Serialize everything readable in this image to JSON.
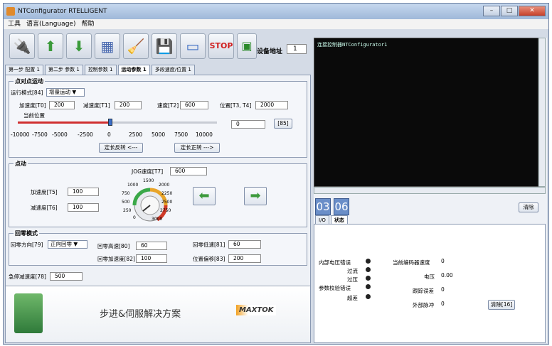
{
  "window": {
    "title": "NTConfigurator RTELLIGENT"
  },
  "menu": [
    "工具",
    "语言(Language)",
    "帮助"
  ],
  "toolbar": {
    "device_addr_label": "设备地址",
    "device_addr_value": "1"
  },
  "tabs": [
    "第一步 配置 1",
    "第二步 参数 1",
    "控制参数 1",
    "运动参数 1",
    "多段速度/位置 1"
  ],
  "p2p": {
    "title": "点对点运动",
    "mode_label": "运行模式[84]",
    "mode_value": "增量运动",
    "accel_label": "加速度[T0]",
    "accel_value": "200",
    "decel_label": "减速度[T1]",
    "decel_value": "200",
    "speed_label": "速度[T2]",
    "speed_value": "600",
    "pos_label": "位置[T3, T4]",
    "pos_value": "2000",
    "curpos_label": "当前位置",
    "curpos_value": "0",
    "btn85": "[85]",
    "ticks": [
      "-10000",
      "-7500",
      "-5000",
      "-2500",
      "0",
      "2500",
      "5000",
      "7500",
      "10000"
    ],
    "rev_btn": "定长反转 <---",
    "fwd_btn": "定长正转 --->"
  },
  "jog": {
    "title": "点动",
    "jog_speed_label": "JOG速度[T7]",
    "jog_speed_value": "600",
    "accel_label": "加速度[T5]",
    "accel_value": "100",
    "decel_label": "减速度[T6]",
    "decel_value": "100",
    "dial_labels": [
      "0",
      "250",
      "500",
      "750",
      "1000",
      "1500",
      "2000",
      "2250",
      "2500",
      "2750",
      "3000"
    ]
  },
  "home": {
    "title": "回零模式",
    "dir_label": "回零方向[79]",
    "dir_value": "正向回零",
    "hspeed_label": "回零高速[80]",
    "hspeed_value": "60",
    "lspeed_label": "回零低速[81]",
    "lspeed_value": "60",
    "haccel_label": "回零加速度[82]",
    "haccel_value": "100",
    "offset_label": "位置偏移[83]",
    "offset_value": "200"
  },
  "estop": {
    "label": "急停减速度[78]",
    "value": "500"
  },
  "brand": {
    "slogan": "步进&伺服解决方案",
    "logo": "MAXTOK"
  },
  "console": {
    "line": "连接控制器NTConfigurator1"
  },
  "leds": [
    "03",
    "06"
  ],
  "clear_btn": "清除",
  "status": {
    "tabs": [
      "I/O",
      "状态"
    ],
    "left": [
      "内部电压错误",
      "过流",
      "过压",
      "参数校验错误",
      "超差"
    ],
    "right": [
      {
        "label": "当前编码器速度",
        "value": "0"
      },
      {
        "label": "电压",
        "value": "0.00"
      },
      {
        "label": "跟踪误差",
        "value": "0"
      },
      {
        "label": "外部脉冲",
        "value": "0"
      }
    ],
    "clear_btn": "清除[16]"
  }
}
